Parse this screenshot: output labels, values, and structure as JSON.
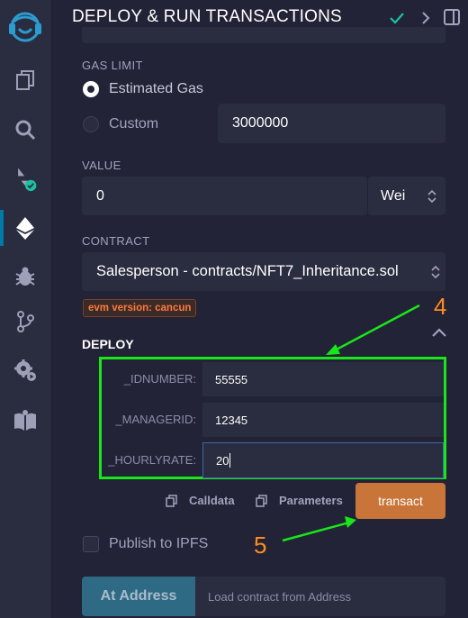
{
  "header": {
    "title": "DEPLOY & RUN TRANSACTIONS"
  },
  "gas": {
    "label": "GAS LIMIT",
    "estimated_label": "Estimated Gas",
    "custom_label": "Custom",
    "custom_value": "3000000",
    "selected": "estimated"
  },
  "value": {
    "label": "VALUE",
    "amount": "0",
    "unit": "Wei"
  },
  "contract": {
    "label": "CONTRACT",
    "selected": "Salesperson - contracts/NFT7_Inheritance.sol",
    "evm_badge": "evm version: cancun"
  },
  "deploy": {
    "label": "DEPLOY",
    "params": [
      {
        "name": "_IDNUMBER:",
        "value": "55555"
      },
      {
        "name": "_MANAGERID:",
        "value": "12345"
      },
      {
        "name": "_HOURLYRATE:",
        "value": "20"
      }
    ],
    "calldata_label": "Calldata",
    "parameters_label": "Parameters",
    "transact_label": "transact"
  },
  "publish": {
    "label": "Publish to IPFS"
  },
  "at_address": {
    "button_label": "At Address",
    "placeholder": "Load contract from Address"
  },
  "annotations": {
    "step4": "4",
    "step5": "5"
  },
  "colors": {
    "background": "#222336",
    "panel_field": "#2a2c3f",
    "transact": "#c97539",
    "highlight_box": "#19e619",
    "annotation_text": "#ff8c1a",
    "badge_text": "#ff7a3d",
    "check": "#1ac2a2"
  }
}
